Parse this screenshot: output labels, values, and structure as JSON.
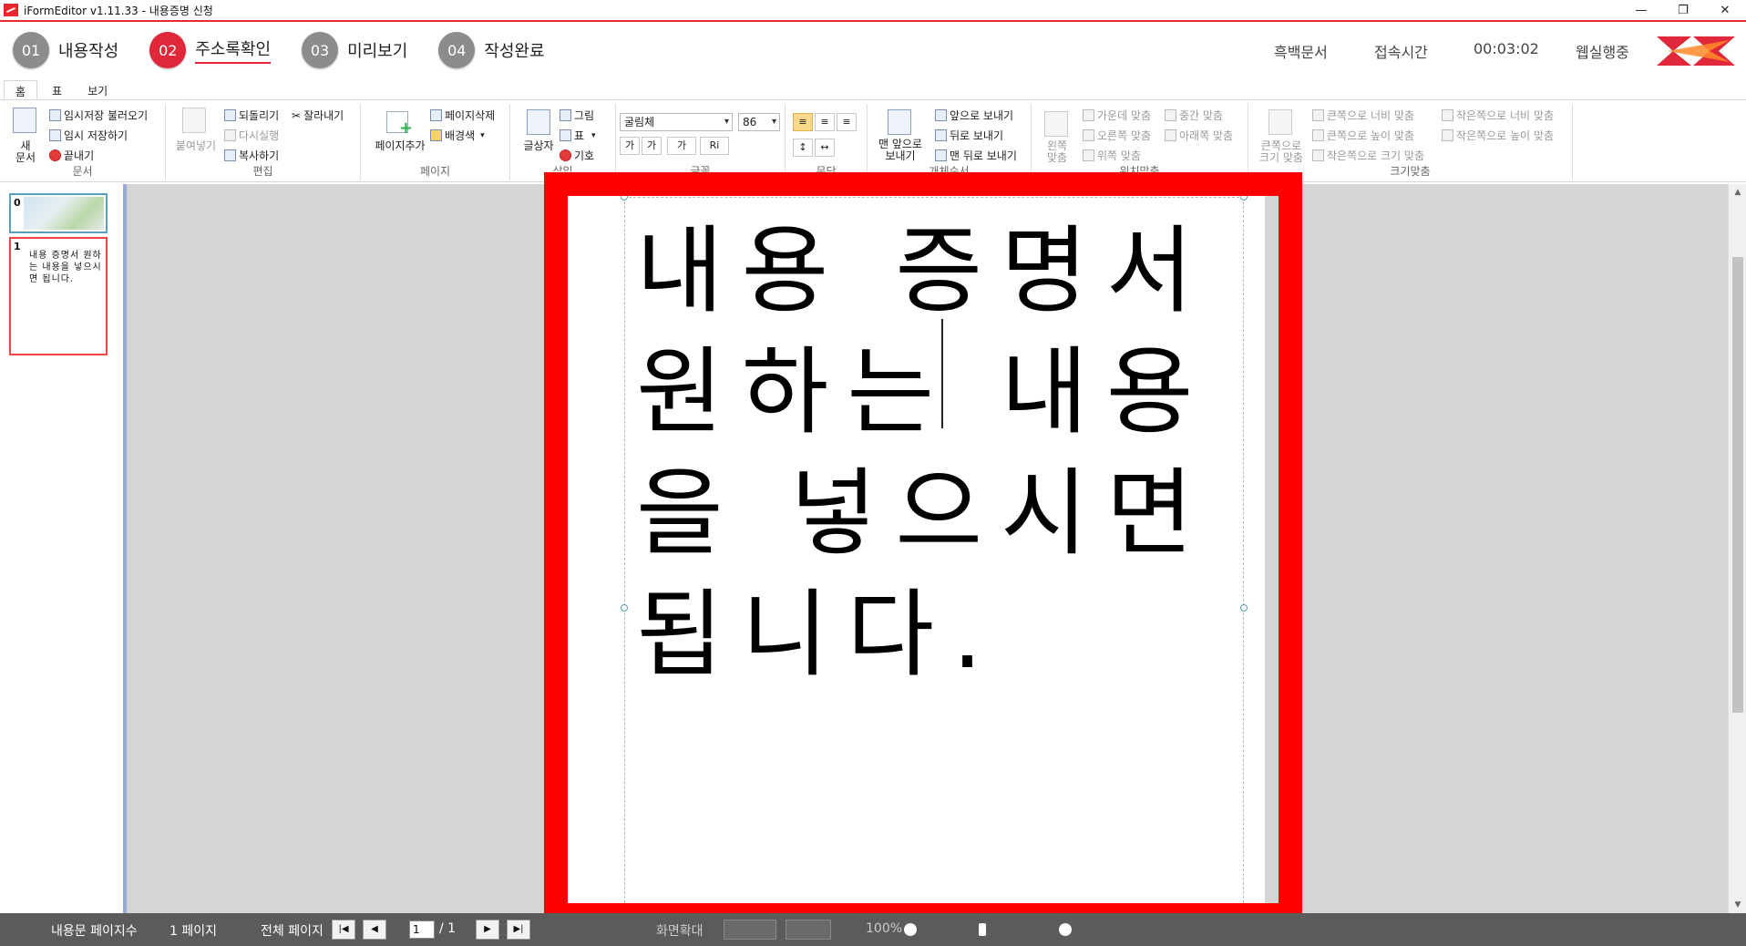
{
  "window": {
    "title": "iFormEditor v1.11.33 - 내용증명 신청",
    "controls": [
      "—",
      "❐",
      "✕"
    ]
  },
  "steps": [
    {
      "num": "01",
      "label": "내용작성",
      "active": false
    },
    {
      "num": "02",
      "label": "주소록확인",
      "active": true
    },
    {
      "num": "03",
      "label": "미리보기",
      "active": false
    },
    {
      "num": "04",
      "label": "작성완료",
      "active": false
    }
  ],
  "status": {
    "doc_type": "흑백문서",
    "time_label": "접속시간",
    "time_value": "00:03:02",
    "state": "웹실행중"
  },
  "ribbon_tabs": [
    "홈",
    "표",
    "보기"
  ],
  "ribbon": {
    "doc": {
      "new_doc": "새\n문서",
      "load_temp": "임시저장 불러오기",
      "save_temp": "임시 저장하기",
      "exit": "끝내기",
      "label": "문서"
    },
    "edit": {
      "paste": "붙여넣기",
      "undo": "되돌리기",
      "redo": "다시실행",
      "copy": "복사하기",
      "cut": "잘라내기",
      "label": "편집"
    },
    "page": {
      "add": "페이지추가",
      "delete": "페이지삭제",
      "bg": "배경색",
      "label": "페이지"
    },
    "insert": {
      "textbox": "글상자",
      "image": "그림",
      "table": "표",
      "symbol": "기호",
      "label": "삽입"
    },
    "font": {
      "face": "굴림체",
      "size": "86",
      "bold": "가",
      "outline": "가",
      "color": "가",
      "highlight": "Ri",
      "label": "글꼴"
    },
    "para": {
      "label": "문단"
    },
    "order": {
      "bring_front_most": "맨 앞으로\n보내기",
      "bring_forward": "앞으로 보내기",
      "send_backward": "뒤로 보내기",
      "send_back_most": "맨 뒤로 보내기",
      "label": "개체순서"
    },
    "align": {
      "left": "왼쪽\n맞춤",
      "center": "가운데 맞춤",
      "right": "오른쪽 맞춤",
      "top": "위쪽 맞춤",
      "middle": "중간 맞춤",
      "bottom": "아래쪽 맞춤",
      "label": "위치맞춤"
    },
    "size": {
      "big_fit": "큰쪽으로\n크기 맞춤",
      "big_width": "큰쪽으로 너비 맞춤",
      "big_height": "큰쪽으로 높이 맞춤",
      "small_size": "작은쪽으로 크기 맞춤",
      "small_width": "작은쪽으로 너비 맞춤",
      "small_height": "작은쪽으로 높이 맞춤",
      "label": "크기맞춤"
    }
  },
  "thumbnails": [
    {
      "num": "0",
      "text": ""
    },
    {
      "num": "1",
      "text": "내용 증명서 원하는 내용을 넣으시면 됩니다."
    }
  ],
  "document": {
    "lines": [
      "내용 증명서",
      "원하는 내용",
      "을 넣으시면",
      "됩니다."
    ]
  },
  "statusbar": {
    "page_count_label": "내용문 페이지수",
    "page_count_value": "1 페이지",
    "total_label": "전체 페이지",
    "current_page": "1",
    "total_pages": "/ 1",
    "zoom_label": "화면확대",
    "zoom_value": "100%",
    "nav": [
      "|◀",
      "◀",
      "▶",
      "▶|"
    ]
  },
  "colors": {
    "accent_red": "#e0283a",
    "step_grey": "#8c8c8c",
    "highlight_frame": "#ff0000",
    "statusbar_bg": "#5b5b5b"
  }
}
